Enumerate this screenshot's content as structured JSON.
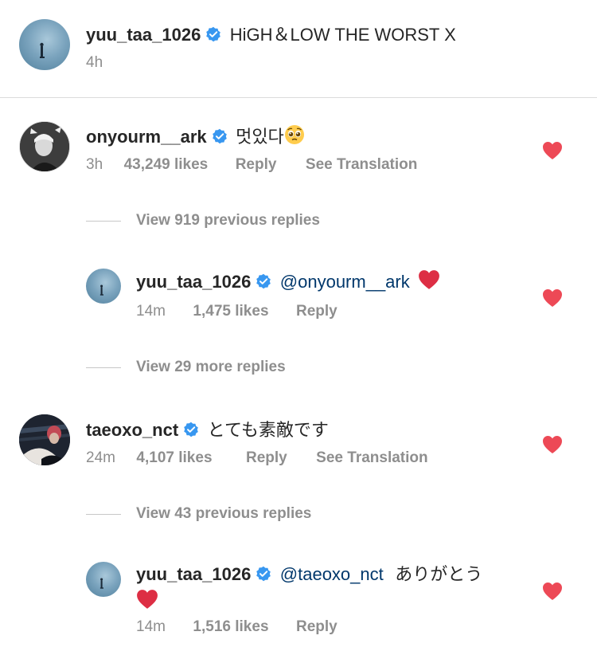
{
  "post": {
    "username": "yuu_taa_1026",
    "caption": "HiGH＆LOW THE WORST X",
    "time": "4h"
  },
  "comments": [
    {
      "username": "onyourm__ark",
      "text": "멋있다",
      "emoji": "pleading-face",
      "time": "3h",
      "likes": "43,249 likes",
      "reply": "Reply",
      "translate": "See Translation",
      "view_replies": "View 919 previous replies",
      "reply_item": {
        "username": "yuu_taa_1026",
        "mention": "@onyourm__ark",
        "text": "",
        "emoji": "red-heart",
        "time": "14m",
        "likes": "1,475 likes",
        "reply": "Reply"
      },
      "more_replies": "View 29 more replies"
    },
    {
      "username": "taeoxo_nct",
      "text": "とても素敵です",
      "time": "24m",
      "likes": "4,107 likes",
      "reply": "Reply",
      "translate": "See Translation",
      "view_replies": "View 43 previous replies",
      "reply_item": {
        "username": "yuu_taa_1026",
        "mention": "@taeoxo_nct",
        "text": "ありがとう",
        "emoji": "red-heart",
        "time": "14m",
        "likes": "1,516 likes",
        "reply": "Reply"
      }
    }
  ],
  "colors": {
    "verified": "#3897f0",
    "heart": "#ed4956",
    "mention": "#00376b",
    "meta": "#8e8e8e"
  }
}
